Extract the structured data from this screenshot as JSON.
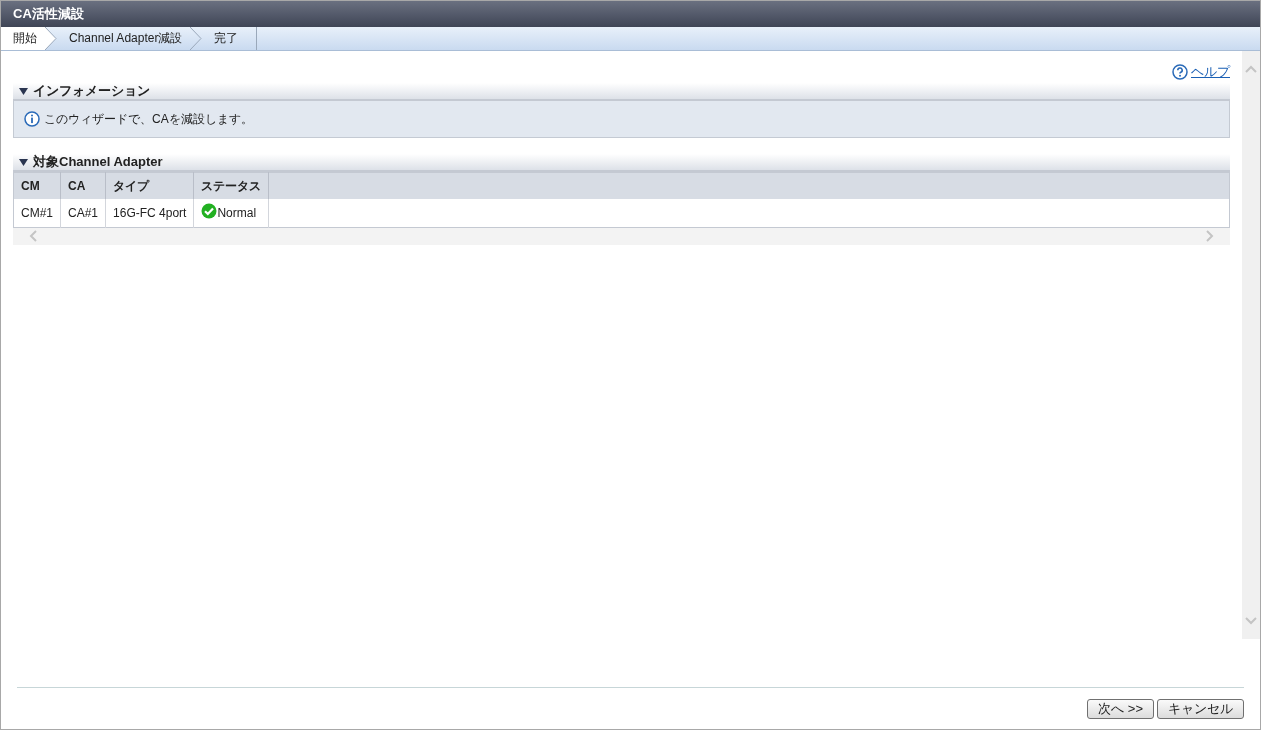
{
  "window": {
    "title": "CA活性減設"
  },
  "steps": [
    {
      "label": "開始",
      "selected": true
    },
    {
      "label": "Channel Adapter減設",
      "selected": false
    },
    {
      "label": "完了",
      "selected": false
    }
  ],
  "help_link": "ヘルプ",
  "information": {
    "title": "インフォメーション",
    "expanded": true,
    "message": "このウィザードで、CAを減設します。"
  },
  "target": {
    "title": "対象Channel Adapter",
    "expanded": true,
    "table": {
      "columns": [
        "CM",
        "CA",
        "タイプ",
        "ステータス"
      ],
      "rows": [
        {
          "cells": [
            "CM#1",
            "CA#1",
            "16G-FC 4port",
            "Normal"
          ],
          "ok": true
        }
      ]
    }
  },
  "buttons": [
    "次へ >>",
    "キャンセル"
  ]
}
